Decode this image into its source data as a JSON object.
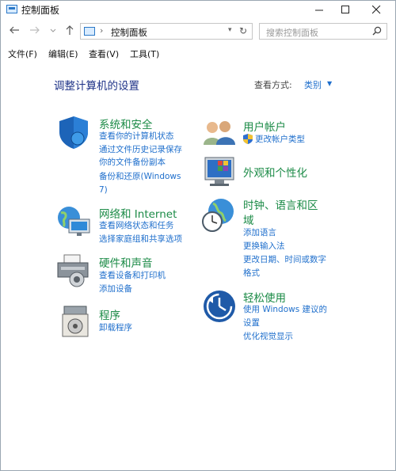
{
  "window": {
    "title": "控制面板"
  },
  "nav": {
    "address_label": "控制面板",
    "search_placeholder": "搜索控制面板"
  },
  "menu": [
    "文件(F)",
    "编辑(E)",
    "查看(V)",
    "工具(T)"
  ],
  "main": {
    "heading": "调整计算机的设置",
    "view_by_label": "查看方式:",
    "view_by_value": "类别"
  },
  "categories": {
    "system_security": {
      "title": "系统和安全",
      "links": [
        "查看你的计算机状态",
        "通过文件历史记录保存",
        "你的文件备份副本",
        "备份和还原(Windows",
        "7)"
      ]
    },
    "network": {
      "title": "网络和 Internet",
      "links": [
        "查看网络状态和任务",
        "选择家庭组和共享选项"
      ]
    },
    "hardware": {
      "title": "硬件和声音",
      "links": [
        "查看设备和打印机",
        "添加设备"
      ]
    },
    "programs": {
      "title": "程序",
      "links": [
        "卸载程序"
      ]
    },
    "user_accounts": {
      "title": "用户帐户",
      "links": [
        "更改帐户类型"
      ]
    },
    "appearance": {
      "title": "外观和个性化",
      "links": []
    },
    "clock": {
      "title_line1": "时钟、语言和区",
      "title_line2": "域",
      "links": [
        "添加语言",
        "更换输入法",
        "更改日期、时间或数字",
        "格式"
      ]
    },
    "ease": {
      "title": "轻松使用",
      "links": [
        "使用 Windows 建议的",
        "设置",
        "优化视觉显示"
      ]
    }
  },
  "colors": {
    "category_title": "#1c8b47",
    "link": "#1f6fcc",
    "heading": "#1e3287"
  }
}
